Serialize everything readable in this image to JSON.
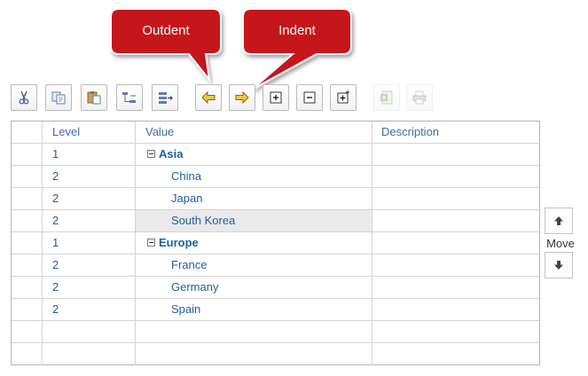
{
  "callouts": {
    "outdent": "Outdent",
    "indent": "Indent"
  },
  "toolbar": {
    "buttons": [
      {
        "name": "cut",
        "icon": "scissors-icon",
        "enabled": true
      },
      {
        "name": "copy",
        "icon": "copy-icon",
        "enabled": true
      },
      {
        "name": "paste",
        "icon": "paste-icon",
        "enabled": true
      },
      {
        "name": "insert-child",
        "icon": "insert-child-icon",
        "enabled": true
      },
      {
        "name": "insert-sibling",
        "icon": "insert-sibling-icon",
        "enabled": true
      },
      {
        "name": "outdent",
        "icon": "arrow-left-icon",
        "enabled": true
      },
      {
        "name": "indent",
        "icon": "arrow-right-icon",
        "enabled": true
      },
      {
        "name": "expand-all",
        "icon": "plus-box-icon",
        "enabled": true
      },
      {
        "name": "collapse-all",
        "icon": "minus-box-icon",
        "enabled": true
      },
      {
        "name": "add-item",
        "icon": "plus-sparkle-icon",
        "enabled": true
      },
      {
        "name": "export-excel",
        "icon": "excel-icon",
        "enabled": false
      },
      {
        "name": "print",
        "icon": "printer-icon",
        "enabled": false
      }
    ]
  },
  "grid": {
    "columns": [
      "Level",
      "Value",
      "Description"
    ],
    "rows": [
      {
        "level": "1",
        "value": "Asia",
        "description": "",
        "group": true
      },
      {
        "level": "2",
        "value": "China",
        "description": "",
        "group": false
      },
      {
        "level": "2",
        "value": "Japan",
        "description": "",
        "group": false
      },
      {
        "level": "2",
        "value": "South Korea",
        "description": "",
        "group": false,
        "selected": true
      },
      {
        "level": "1",
        "value": "Europe",
        "description": "",
        "group": true
      },
      {
        "level": "2",
        "value": "France",
        "description": "",
        "group": false
      },
      {
        "level": "2",
        "value": "Germany",
        "description": "",
        "group": false
      },
      {
        "level": "2",
        "value": "Spain",
        "description": "",
        "group": false
      }
    ]
  },
  "move": {
    "label": "Move"
  },
  "colors": {
    "callout_fill": "#c5161d",
    "link_text": "#1f5f9e",
    "selected_row": "#eaeaea"
  }
}
